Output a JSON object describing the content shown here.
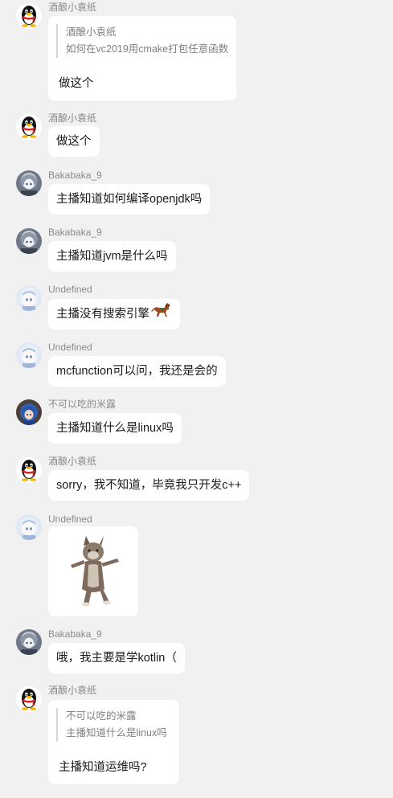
{
  "colors": {
    "background": "#f1f1f2",
    "bubble": "#ffffff",
    "sender_name": "#8a8a8a",
    "quote_text": "#7f7f7f"
  },
  "messages": [
    {
      "sender": "酒酿小袁纸",
      "avatar_icon": "qq-penguin-avatar-icon",
      "quote": {
        "author": "酒酿小袁纸",
        "text": "如何在vc2019用cmake打包任意函数"
      },
      "text": "做这个"
    },
    {
      "sender": "酒酿小袁纸",
      "avatar_icon": "qq-penguin-avatar-icon",
      "text": "做这个"
    },
    {
      "sender": "Bakabaka_9",
      "avatar_icon": "anime-avatar-icon",
      "text": "主播知道如何编译openjdk吗"
    },
    {
      "sender": "Bakabaka_9",
      "avatar_icon": "anime-avatar-icon",
      "text": "主播知道jvm是什么吗"
    },
    {
      "sender": "Undefined",
      "avatar_icon": "anime-girl-avatar-icon",
      "text": "主播没有搜索引擎",
      "emoji_icon": "horse-emoji-icon"
    },
    {
      "sender": "Undefined",
      "avatar_icon": "anime-girl-avatar-icon",
      "text": "mcfunction可以问，我还是会的"
    },
    {
      "sender": "不可以吃的米露",
      "avatar_icon": "blue-hair-avatar-icon",
      "text": "主播知道什么是linux吗"
    },
    {
      "sender": "酒酿小袁纸",
      "avatar_icon": "qq-penguin-avatar-icon",
      "text": "sorry，我不知道，毕竟我只开发c++"
    },
    {
      "sender": "Undefined",
      "avatar_icon": "anime-girl-avatar-icon",
      "sticker_icon": "dancing-cat-sticker-icon"
    },
    {
      "sender": "Bakabaka_9",
      "avatar_icon": "anime-avatar-icon",
      "text": "哦，我主要是学kotlin（"
    },
    {
      "sender": "酒酿小袁纸",
      "avatar_icon": "qq-penguin-avatar-icon",
      "quote": {
        "author": "不可以吃的米露",
        "text": "主播知道什么是linux吗"
      },
      "text": "主播知道运维吗?"
    }
  ]
}
